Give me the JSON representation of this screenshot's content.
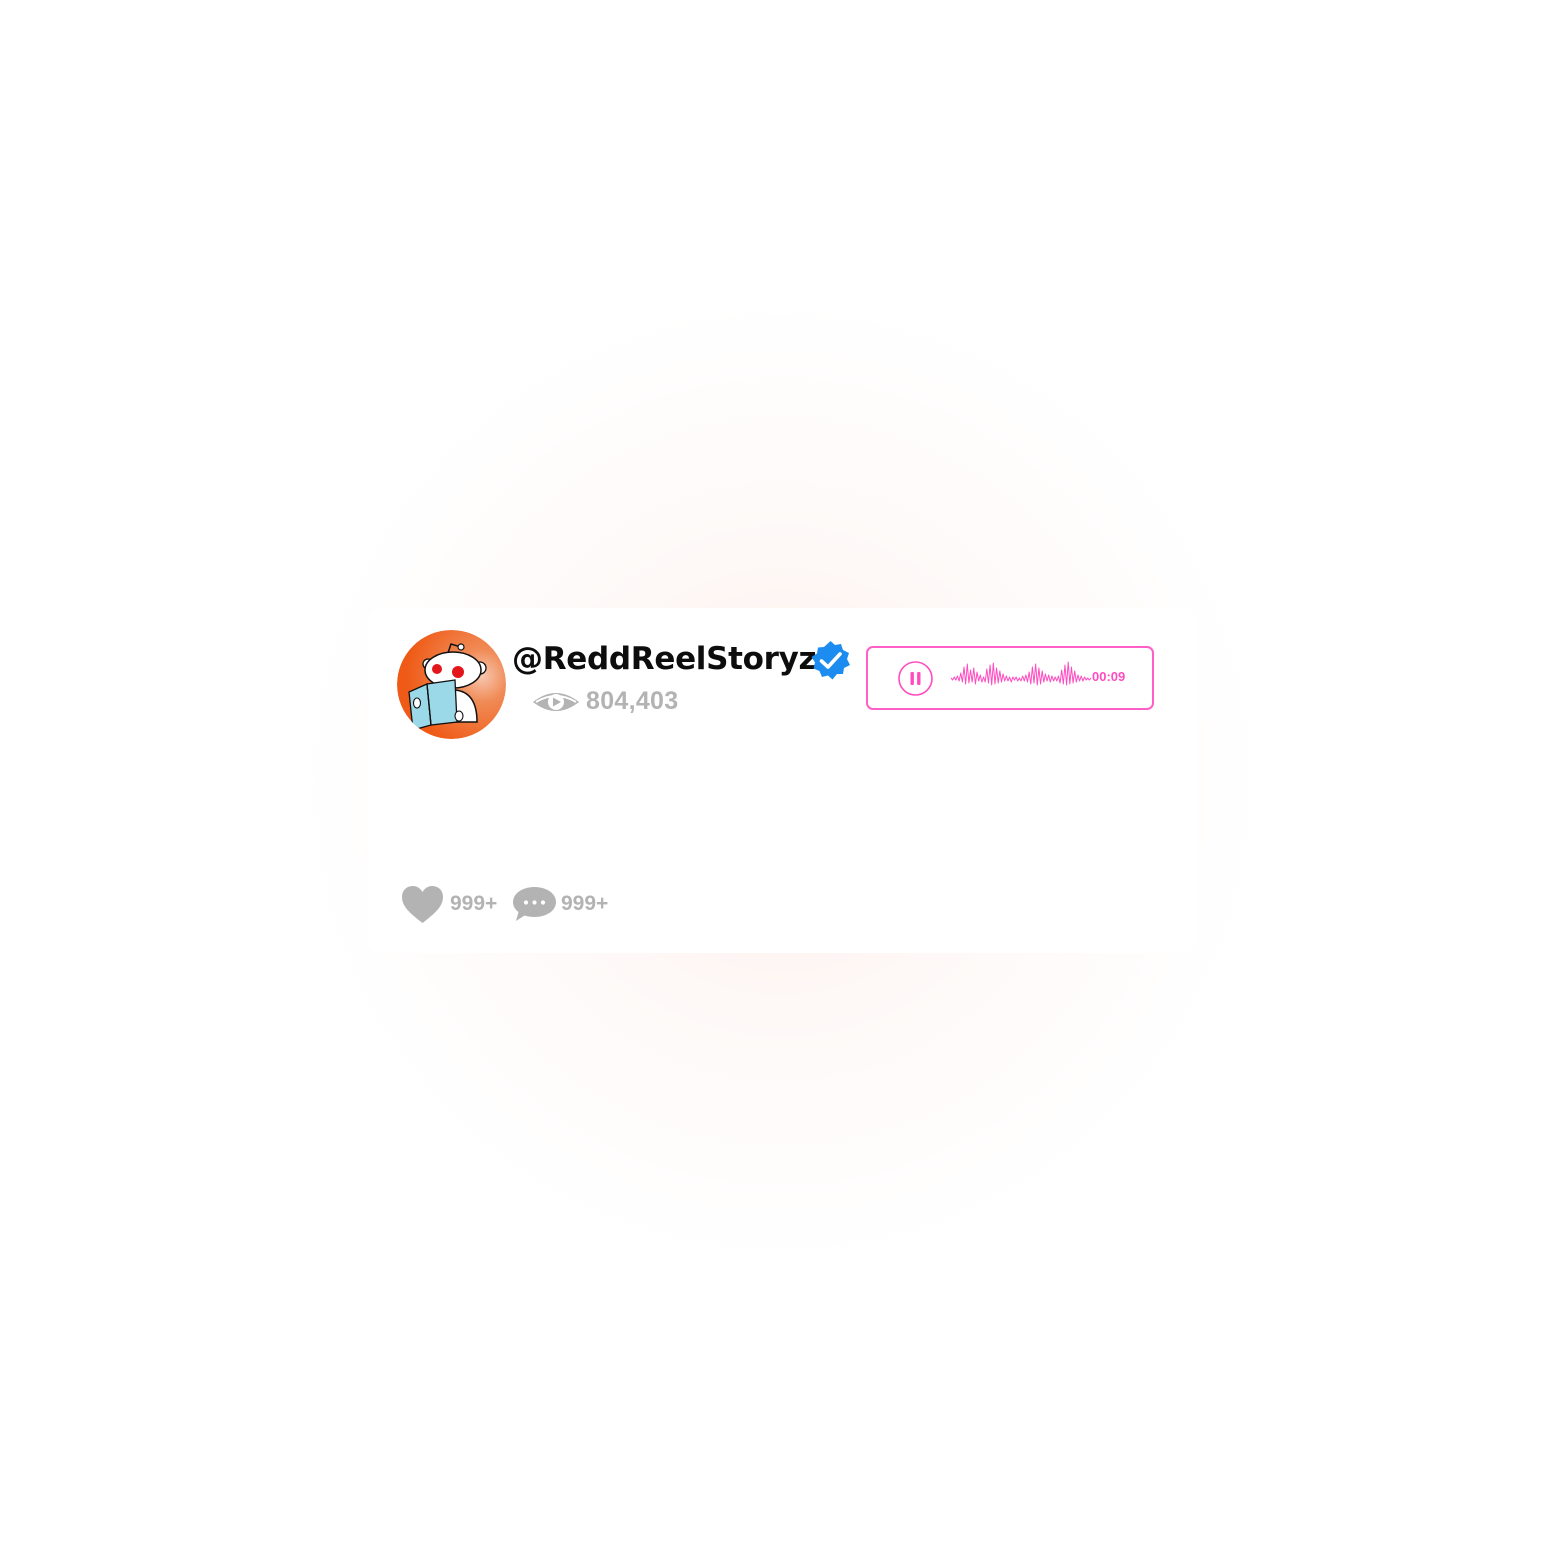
{
  "profile": {
    "username": "@ReddReelStoryz",
    "views": "804,403",
    "avatar_icon": "reddit-snoo-reading-book-avatar",
    "verified_icon": "verified-badge-icon"
  },
  "audio_player": {
    "time": "00:09",
    "state_icon": "pause-icon",
    "accent_color": "#ff5fc6"
  },
  "engagement": {
    "likes": "999+",
    "comments": "999+",
    "like_icon": "heart-icon",
    "comment_icon": "comment-bubble-icon"
  },
  "colors": {
    "avatar_orange": "#f05a1a",
    "verified_blue": "#1d8cf0",
    "muted_gray": "#b3b3b3"
  }
}
